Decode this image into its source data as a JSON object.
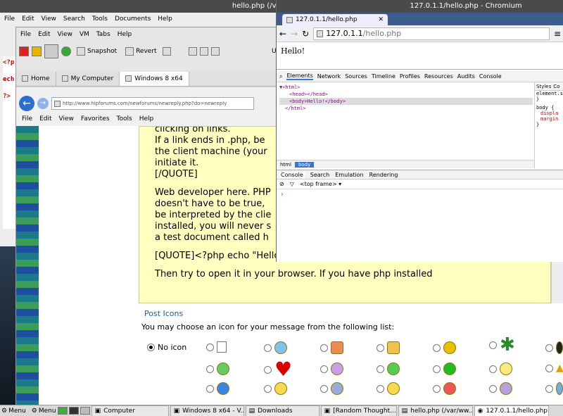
{
  "gedit": {
    "title": "hello.php (/var/www) - gedit",
    "menu": [
      "File",
      "Edit",
      "View",
      "Search",
      "Tools",
      "Documents",
      "Help"
    ],
    "code_fragments": [
      "<?p",
      "ech",
      "?>"
    ]
  },
  "vbox": {
    "menu": [
      "File",
      "Edit",
      "View",
      "VM",
      "Tabs",
      "Help"
    ],
    "toolbar": {
      "snapshot": "Snapshot",
      "revert": "Revert",
      "unity": "Unity"
    },
    "tabs": [
      "Home",
      "My Computer",
      "Windows 8 x64"
    ]
  },
  "ie": {
    "url": "http://www.hipforums.com/newforums/newreply.php?do=newreply",
    "menu": [
      "File",
      "Edit",
      "View",
      "Favorites",
      "Tools",
      "Help"
    ],
    "editor_lines": [
      "clicking on links.",
      "If a link ends in .php, be",
      "the client machine (your",
      "initiate it.",
      " [/QUOTE]",
      "",
      "Web developer here. PHP",
      "doesn't have to be true,",
      "be interpreted by the clie",
      "installed, you will never s",
      "a test document called h",
      "",
      "[QUOTE]<?php echo \"Hello!\"; ?>[/QUOTE]",
      "",
      "Then try to open it in your browser. If you have php installed"
    ],
    "post_icons": {
      "heading": "Post Icons",
      "instruction": "You may choose an icon for your message from the following list:",
      "no_icon_label": "No icon",
      "selected": "No icon"
    }
  },
  "chromium": {
    "title": "127.0.1.1/hello.php - Chromium",
    "tab_label": "127.0.1.1/hello.php",
    "address_host": "127.0.1.1",
    "address_path": "/hello.php",
    "page_text": "Hello!",
    "devtools": {
      "tabs": [
        "Elements",
        "Network",
        "Sources",
        "Timeline",
        "Profiles",
        "Resources",
        "Audits",
        "Console"
      ],
      "dom": [
        "▼<html>",
        "<head></head>",
        "<body>Hello!</body>",
        "</html>"
      ],
      "breadcrumbs": [
        "html",
        "body"
      ],
      "side_tabs": [
        "Styles",
        "Co"
      ],
      "styles": [
        "element.s",
        "}",
        "body {",
        "displa",
        "margin",
        "}"
      ],
      "drawer_tabs": [
        "Console",
        "Search",
        "Emulation",
        "Rendering"
      ],
      "frame": "<top frame>",
      "prompt": "›"
    }
  },
  "taskbar": {
    "start1": "Menu",
    "start2": "Menu",
    "items": [
      "Computer",
      "Windows 8 x64 - V...",
      "Downloads",
      "[Random Thought...",
      "hello.php (/var/ww...",
      "127.0.1.1/hello.php"
    ]
  },
  "colors": {
    "title_bar": "#4a4a4a",
    "ie_blue": "#2a6fd0",
    "editor_bg": "#ffffc0",
    "devtools_selected": "#3875d7"
  }
}
